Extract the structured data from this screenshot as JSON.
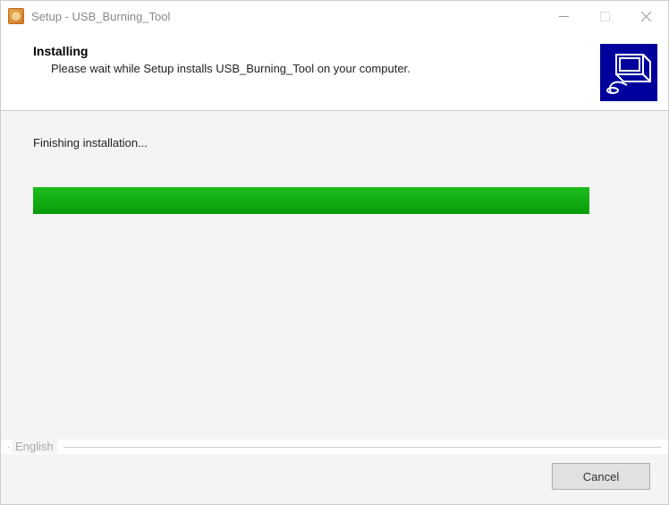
{
  "window": {
    "title": "Setup - USB_Burning_Tool"
  },
  "header": {
    "title": "Installing",
    "subtitle": "Please wait while Setup installs USB_Burning_Tool on your computer."
  },
  "content": {
    "status": "Finishing installation...",
    "progress_percent": 100
  },
  "footer": {
    "language": "English",
    "cancel_label": "Cancel"
  }
}
